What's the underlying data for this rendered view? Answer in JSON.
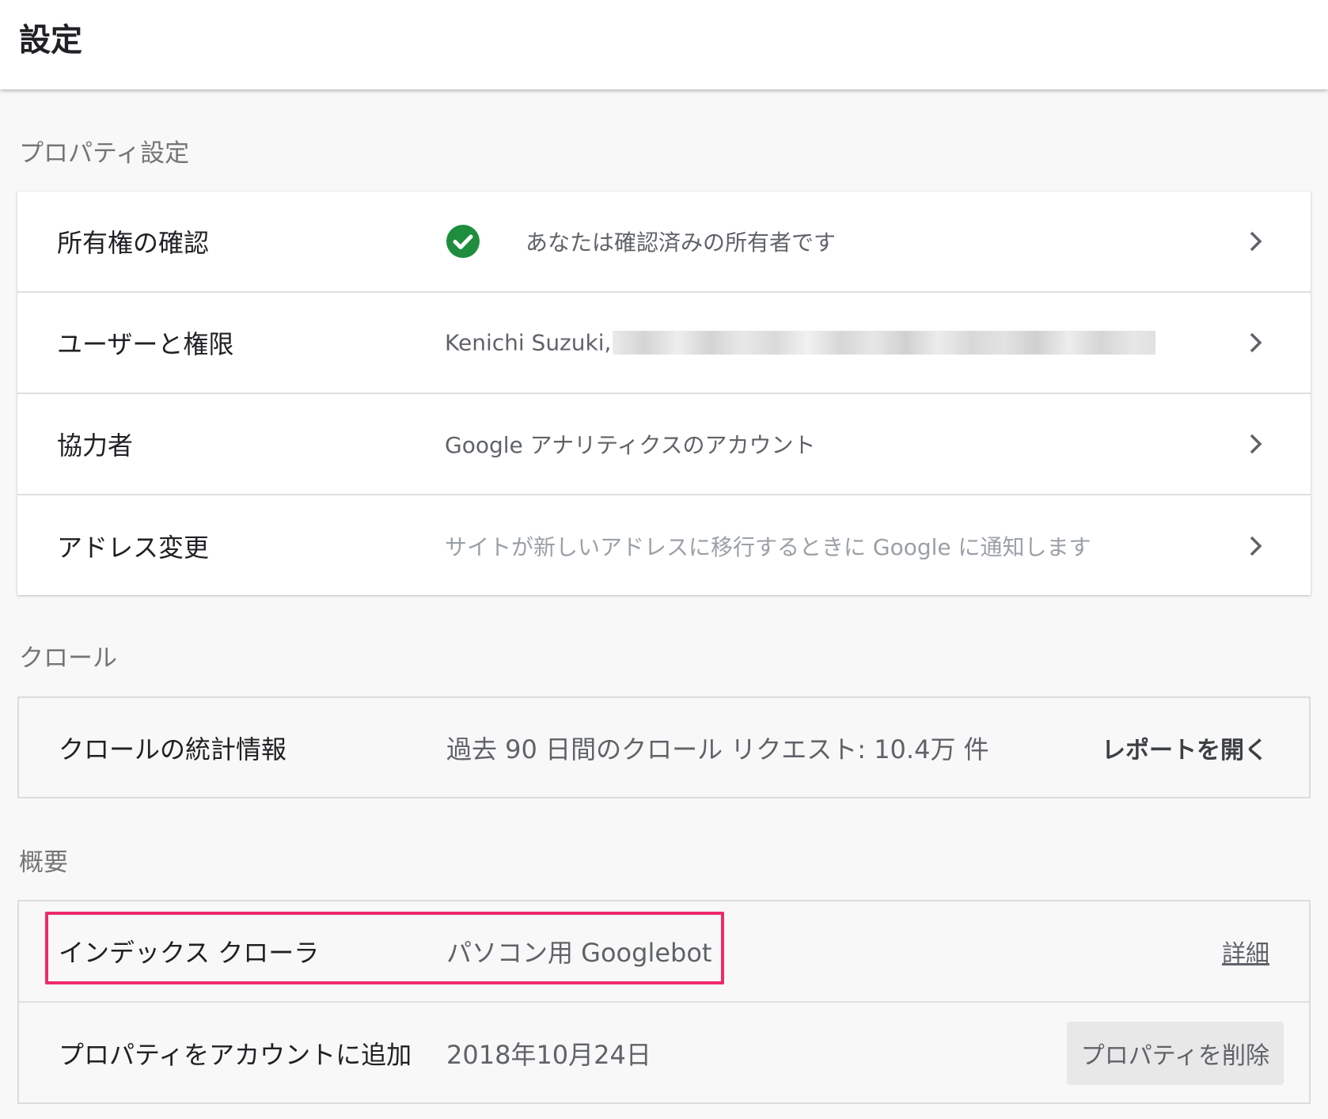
{
  "page": {
    "title": "設定"
  },
  "sections": {
    "property": {
      "heading": "プロパティ設定",
      "rows": [
        {
          "label": "所有権の確認",
          "value": "あなたは確認済みの所有者です"
        },
        {
          "label": "ユーザーと権限",
          "value": "Kenichi Suzuki,"
        },
        {
          "label": "協力者",
          "value": "Google アナリティクスのアカウント"
        },
        {
          "label": "アドレス変更",
          "value": "サイトが新しいアドレスに移行するときに Google に通知します"
        }
      ]
    },
    "crawl": {
      "heading": "クロール",
      "row": {
        "label": "クロールの統計情報",
        "value": "過去 90 日間のクロール リクエスト: 10.4万 件",
        "action": "レポートを開く"
      }
    },
    "overview": {
      "heading": "概要",
      "rows": [
        {
          "label": "インデックス クローラ",
          "value": "パソコン用 Googlebot",
          "action": "詳細"
        },
        {
          "label": "プロパティをアカウントに追加",
          "value": "2018年10月24日",
          "action": "プロパティを削除"
        }
      ]
    }
  },
  "colors": {
    "check": "#1e8e3e",
    "highlight": "#ee2a6a"
  },
  "icons": {
    "verified": "check-circle-icon",
    "row_arrow": "chevron-right-icon"
  }
}
